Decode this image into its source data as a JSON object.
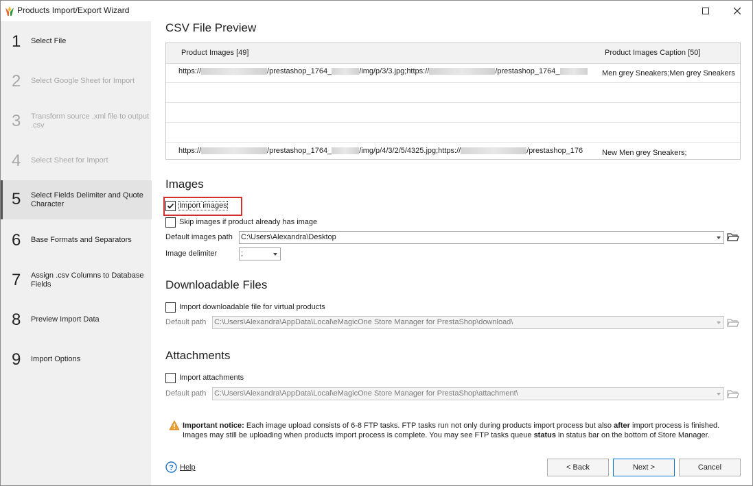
{
  "window": {
    "title": "Products Import/Export Wizard"
  },
  "steps": [
    {
      "num": "1",
      "label": "Select File",
      "state": "normal"
    },
    {
      "num": "2",
      "label": "Select Google Sheet for Import",
      "state": "disabled"
    },
    {
      "num": "3",
      "label": "Transform source .xml file to output .csv",
      "state": "disabled"
    },
    {
      "num": "4",
      "label": "Select Sheet for Import",
      "state": "disabled"
    },
    {
      "num": "5",
      "label": "Select Fields Delimiter and Quote Character",
      "state": "active"
    },
    {
      "num": "6",
      "label": "Base Formats and Separators",
      "state": "normal"
    },
    {
      "num": "7",
      "label": "Assign .csv Columns to Database Fields",
      "state": "normal"
    },
    {
      "num": "8",
      "label": "Preview Import Data",
      "state": "normal"
    },
    {
      "num": "9",
      "label": "Import Options",
      "state": "normal"
    }
  ],
  "preview": {
    "title": "CSV File Preview",
    "col1": "Product Images [49]",
    "col2": "Product Images Caption [50]",
    "row1": {
      "a": "https://",
      "b": "/prestashop_1764_",
      "c": "/img/p/3/3.jpg;https://",
      "d": "/prestashop_1764_",
      "caption": "Men grey Sneakers;Men grey Sneakers"
    },
    "row5": {
      "a": "https://",
      "b": "/prestashop_1764_",
      "c": "/img/p/4/3/2/5/4325.jpg;https://",
      "d": "/prestashop_176",
      "caption": "New Men grey Sneakers;"
    }
  },
  "images": {
    "title": "Images",
    "import_label": "Import images",
    "import_checked": true,
    "skip_label": "Skip images if product already has image",
    "skip_checked": false,
    "path_label": "Default images path",
    "path_value": "C:\\Users\\Alexandra\\Desktop",
    "delim_label": "Image delimiter",
    "delim_value": ";"
  },
  "downloadable": {
    "title": "Downloadable Files",
    "import_label": "Import downloadable file for virtual products",
    "path_label": "Default path",
    "path_value": "C:\\Users\\Alexandra\\AppData\\Local\\eMagicOne Store Manager for PrestaShop\\download\\"
  },
  "attachments": {
    "title": "Attachments",
    "import_label": "Import attachments",
    "path_label": "Default path",
    "path_value": "C:\\Users\\Alexandra\\AppData\\Local\\eMagicOne Store Manager for PrestaShop\\attachment\\"
  },
  "notice": {
    "bold1": "Important notice:",
    "text1": " Each image upload consists of 6-8 FTP tasks. FTP tasks run not only during products import process but also ",
    "bold2": "after",
    "text2": " import process is finished. Images may still be uploading when products import process is complete. You may see FTP tasks queue ",
    "bold3": "status",
    "text3": " in status bar on the bottom of Store Manager."
  },
  "footer": {
    "help": "Help",
    "back": "< Back",
    "next": "Next >",
    "cancel": "Cancel"
  },
  "colors": {
    "highlight": "#d32f2f",
    "warning": "#f0a030"
  }
}
